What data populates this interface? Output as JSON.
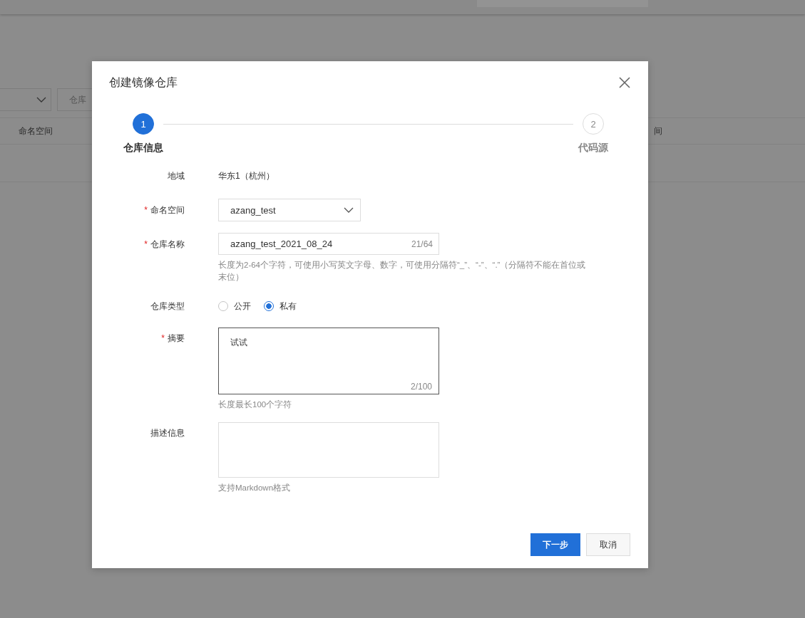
{
  "background": {
    "filter_input": {
      "placeholder": "仓库"
    },
    "table": {
      "columns": [
        "命名空间",
        "间"
      ]
    }
  },
  "dialog": {
    "title": "创建镜像仓库",
    "steps": [
      {
        "number": "1",
        "label": "仓库信息",
        "selected": true
      },
      {
        "number": "2",
        "label": "代码源",
        "selected": false
      }
    ],
    "fields": [
      {
        "kind": "text",
        "label": "地域",
        "value": "华东1（杭州）"
      },
      {
        "kind": "select",
        "label": "命名空间",
        "required_mark": "*",
        "value": "azang_test"
      },
      {
        "kind": "input",
        "label": "仓库名称",
        "required_mark": "*",
        "value": "azang_test_2021_08_24",
        "counter": "21/64",
        "help": "长度为2-64个字符，可使用小写英文字母、数字，可使用分隔符“_”、“-”、“.”（分隔符不能在首位或末位）"
      },
      {
        "kind": "radio",
        "label": "仓库类型",
        "options": [
          {
            "label": "公开",
            "selected": false
          },
          {
            "label": "私有",
            "selected": true
          }
        ]
      },
      {
        "kind": "textarea",
        "label": "摘要",
        "required_mark": "*",
        "value": "试试",
        "counter": "2/100",
        "help": "长度最长100个字符",
        "focused": true
      },
      {
        "kind": "textarea",
        "label": "描述信息",
        "help": "支持Markdown格式",
        "focused": false
      }
    ],
    "buttons": [
      {
        "label": "下一步",
        "primary": true
      },
      {
        "label": "取消",
        "primary": false
      }
    ]
  }
}
